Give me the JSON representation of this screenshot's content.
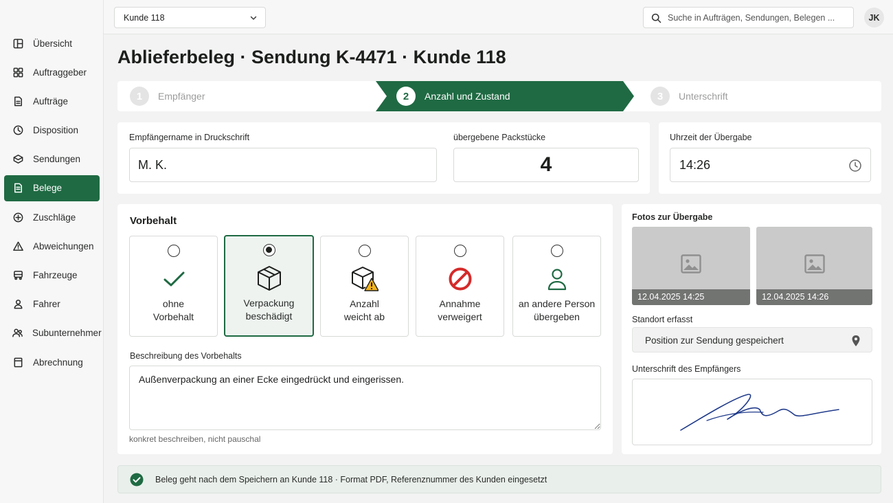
{
  "sidebar": {
    "items": [
      {
        "label": "Übersicht",
        "icon": "overview-icon"
      },
      {
        "label": "Auftraggeber",
        "icon": "clients-icon"
      },
      {
        "label": "Aufträge",
        "icon": "orders-icon"
      },
      {
        "label": "Disposition",
        "icon": "dispatch-icon"
      },
      {
        "label": "Sendungen",
        "icon": "shipments-icon"
      },
      {
        "label": "Belege",
        "icon": "receipts-icon",
        "active": true
      },
      {
        "label": "Zuschläge",
        "icon": "surcharges-icon"
      },
      {
        "label": "Abweichungen",
        "icon": "warning-icon"
      },
      {
        "label": "Fahrzeuge",
        "icon": "vehicle-icon"
      },
      {
        "label": "Fahrer",
        "icon": "driver-icon"
      },
      {
        "label": "Subunternehmer",
        "icon": "subcontractor-icon"
      },
      {
        "label": "Abrechnung",
        "icon": "billing-icon"
      }
    ]
  },
  "topbar": {
    "client_select": "Kunde 118",
    "search_placeholder": "Suche in Aufträgen, Sendungen, Belegen ...",
    "avatar_initials": "JK"
  },
  "page_title": "Ablieferbeleg · Sendung K-4471 · Kunde 118",
  "stepper": {
    "steps": [
      {
        "num": "1",
        "label": "Empfänger"
      },
      {
        "num": "2",
        "label": "Anzahl und Zustand"
      },
      {
        "num": "3",
        "label": "Unterschrift"
      }
    ],
    "active_index": 1
  },
  "recipient": {
    "label": "Empfängername in Druckschrift",
    "value": "M. K."
  },
  "packages": {
    "label": "übergebene Packstücke",
    "value": "4"
  },
  "handover_time": {
    "label": "Uhrzeit der Übergabe",
    "value": "14:26"
  },
  "reservation": {
    "title": "Vorbehalt",
    "options": [
      {
        "label": "ohne\nVorbehalt",
        "icon": "check-icon"
      },
      {
        "label": "Verpackung\nbeschädigt",
        "icon": "damaged-box-icon"
      },
      {
        "label": "Anzahl\nweicht ab",
        "icon": "box-warning-icon"
      },
      {
        "label": "Annahme\nverweigert",
        "icon": "prohibited-icon"
      },
      {
        "label": "an andere Person\nübergeben",
        "icon": "person-icon"
      }
    ],
    "selected_index": 1,
    "description_label": "Beschreibung des Vorbehalts",
    "description_value": "Außenverpackung an einer Ecke eingedrückt und eingerissen.",
    "hint": "konkret beschreiben, nicht pauschal"
  },
  "photos": {
    "title": "Fotos zur Übergabe",
    "items": [
      {
        "caption": "12.04.2025 14:25"
      },
      {
        "caption": "12.04.2025 14:26"
      }
    ]
  },
  "location": {
    "label": "Standort erfasst",
    "value": "Position zur Sendung gespeichert"
  },
  "signature": {
    "label": "Unterschrift des Empfängers"
  },
  "banner": {
    "text": "Beleg geht nach dem Speichern an Kunde 118 · Format PDF, Referenznummer des Kunden eingesetzt"
  },
  "colors": {
    "accent": "#1f6a43",
    "error": "#d42a2a",
    "warning": "#f2b31b",
    "signature_ink": "#1f3a8a"
  }
}
